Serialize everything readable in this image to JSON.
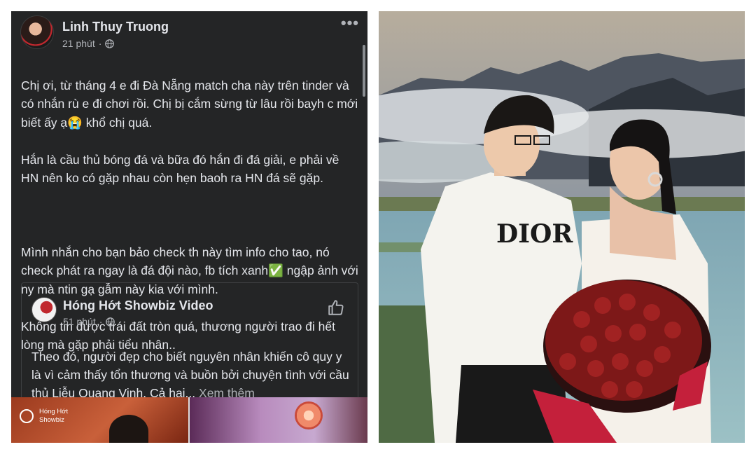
{
  "post": {
    "author": "Linh Thuy Truong",
    "time": "21 phút",
    "more_label": "•••",
    "text": {
      "p1": "Chị ơi, từ tháng 4 e đi Đà Nẵng match cha này trên tinder và có nhắn rù e đi chơi rồi. Chị bị cắm sừng từ lâu rồi bayh c mới biết ấy ạ😭 khổ chị quá.",
      "p2": "Hắn là cầu thủ bóng đá và bữa đó hắn đi đá giải, e phải về HN nên ko có gặp nhau còn hẹn baoh ra HN đá sẽ gặp.",
      "p3": "Mình nhắn cho bạn bảo check th này tìm info cho tao, nó check phát ra ngay là đá đội nào, fb tích xanh✅ ngập ảnh với ny mà ntin gạ gẫm này kia với mình.",
      "p4": "Không tin được trái đất tròn quá, thương người trao đi hết lòng mà gặp phải tiểu nhân.."
    }
  },
  "shared": {
    "page_name": "Hóng Hớt Showbiz Video",
    "time": "51 phút",
    "text": "Theo đó, người đẹp cho biết nguyên nhân khiến cô quy y là vì cảm thấy tổn thương và buồn bởi chuyện tình với cầu thủ Liễu Quang Vinh. Cả hai...",
    "see_more": "Xem thêm",
    "thumb_label": "Hóng Hớt\nShowbiz"
  },
  "photo": {
    "shirt_text": "DIOR"
  },
  "icons": [
    "avatar",
    "globe-icon",
    "more-icon",
    "like-icon",
    "page-logo-icon"
  ],
  "colors": {
    "panel_bg": "#242526",
    "text": "#e4e6eb",
    "muted": "#b0b3b8",
    "border": "#3e4042"
  }
}
